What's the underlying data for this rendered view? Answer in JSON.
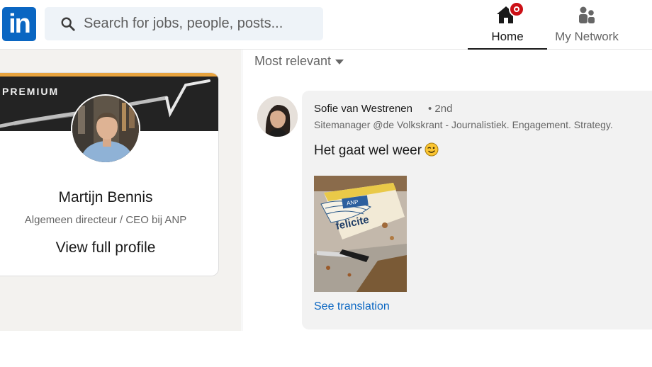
{
  "search": {
    "placeholder": "Search for jobs, people, posts..."
  },
  "nav": {
    "home_label": "Home",
    "network_label": "My Network",
    "accent_color": "#0a66c2",
    "badge_color": "#cc1016"
  },
  "profile_card": {
    "premium_label": "PREMIUM",
    "name": "Martijn Bennis",
    "headline": "Algemeen directeur / CEO bij ANP",
    "view_profile_label": "View full profile"
  },
  "feed": {
    "sort_label": "Most relevant",
    "comment": {
      "author_name": "Sofie van Westrenen",
      "degree": "• 2nd",
      "author_headline": "Sitemanager @de Volkskrant - Journalistiek. Engagement. Strategy.",
      "text": "Het gaat wel weer",
      "image_text": "felicite",
      "image_logo": "ANP",
      "see_translation_label": "See translation"
    }
  }
}
